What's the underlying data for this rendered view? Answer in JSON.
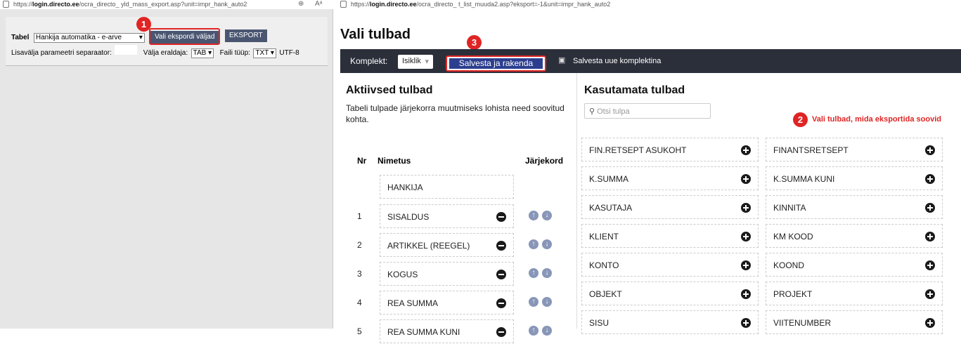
{
  "left_window": {
    "url_prefix": "https://",
    "url_host": "login.directo.ee",
    "url_rest": "/ocra_directo_        yld_mass_export.asp?unit=impr_hank_auto2",
    "form": {
      "tabel_label": "Tabel",
      "tabel_value": "Hankija automatika - e-arve",
      "vali_button": "Vali ekspordi väljad",
      "eksport_button": "EKSPORT",
      "separator_label": "Lisavälja parameetri separaator:",
      "eraldaja_label": "Välja eraldaja:",
      "eraldaja_value": "TAB",
      "failitüüp_label": "Faili tüüp:",
      "failitüüp_value": "TXT",
      "encoding": "UTF-8"
    }
  },
  "right_window": {
    "url_prefix": "https://",
    "url_host": "login.directo.ee",
    "url_rest": "/ocra_directo_        t_list_muuda2.asp?eksport=-1&unit=impr_hank_auto2",
    "page_title": "Vali tulbad",
    "toolbar": {
      "komplekt_label": "Komplekt:",
      "komplekt_value": "Isiklik",
      "save_apply_button": "Salvesta ja rakenda",
      "save_new_link": "Salvesta uue komplektina"
    },
    "active": {
      "heading": "Aktiivsed tulbad",
      "description": "Tabeli tulpade järjekorra muutmiseks lohista need soovitud kohta.",
      "col_nr": "Nr",
      "col_nimetus": "Nimetus",
      "col_jarjekord": "Järjekord",
      "fixed_item": "HANKIJA",
      "rows": [
        {
          "nr": "1",
          "name": "SISALDUS"
        },
        {
          "nr": "2",
          "name": "ARTIKKEL (REEGEL)"
        },
        {
          "nr": "3",
          "name": "KOGUS"
        },
        {
          "nr": "4",
          "name": "REA SUMMA"
        },
        {
          "nr": "5",
          "name": "REA SUMMA KUNI"
        }
      ]
    },
    "unused": {
      "heading": "Kasutamata tulbad",
      "search_placeholder": "Otsi tulpa",
      "items_left": [
        "FIN.RETSEPT ASUKOHT",
        "K.SUMMA",
        "KASUTAJA",
        "KLIENT",
        "KONTO",
        "OBJEKT",
        "SISU"
      ],
      "items_right": [
        "FINANTSRETSEPT",
        "K.SUMMA KUNI",
        "KINNITA",
        "KM KOOD",
        "KOOND",
        "PROJEKT",
        "VIITENUMBER"
      ]
    },
    "annotation": {
      "hint_text": "Vali tulbad, mida eksportida soovid"
    }
  },
  "badges": {
    "b1": "1",
    "b2": "2",
    "b3": "3"
  },
  "colors": {
    "accent_red": "#e02424",
    "header_dark": "#2b2f3a",
    "button_dark": "#4a5671"
  }
}
